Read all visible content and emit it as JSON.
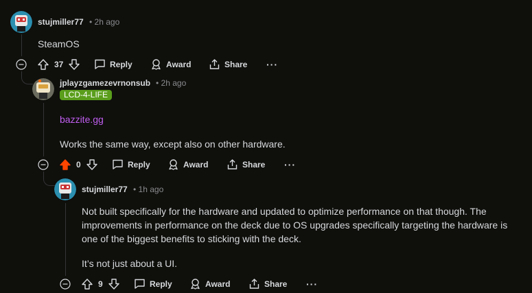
{
  "colors": {
    "background": "#0f0f0c",
    "text": "#d7dadc",
    "meta": "#8a8c8e",
    "link": "#c15ff0",
    "flair_bg": "#5a9e1c",
    "upvoted": "#ff4500"
  },
  "comments": [
    {
      "username": "stujmiller77",
      "time": "• 2h ago",
      "body": [
        "SteamOS"
      ],
      "votes": "37",
      "actions": {
        "reply": "Reply",
        "award": "Award",
        "share": "Share",
        "more": "···"
      }
    },
    {
      "username": "jplayzgamezevrnonsub",
      "time": "• 2h ago",
      "flair": "LCD-4-LIFE",
      "link": "bazzite.gg",
      "body": [
        "Works the same way, except also on other hardware."
      ],
      "votes": "0",
      "upvoted": true,
      "actions": {
        "reply": "Reply",
        "award": "Award",
        "share": "Share",
        "more": "···"
      }
    },
    {
      "username": "stujmiller77",
      "time": "• 1h ago",
      "body": [
        "Not built specifically for the hardware and updated to optimize performance on that though. The improvements in performance on the deck due to OS upgrades specifically targeting the hardware is one of the biggest benefits to sticking with the deck.",
        "It’s not just about a UI."
      ],
      "votes": "9",
      "actions": {
        "reply": "Reply",
        "award": "Award",
        "share": "Share",
        "more": "···"
      }
    }
  ]
}
